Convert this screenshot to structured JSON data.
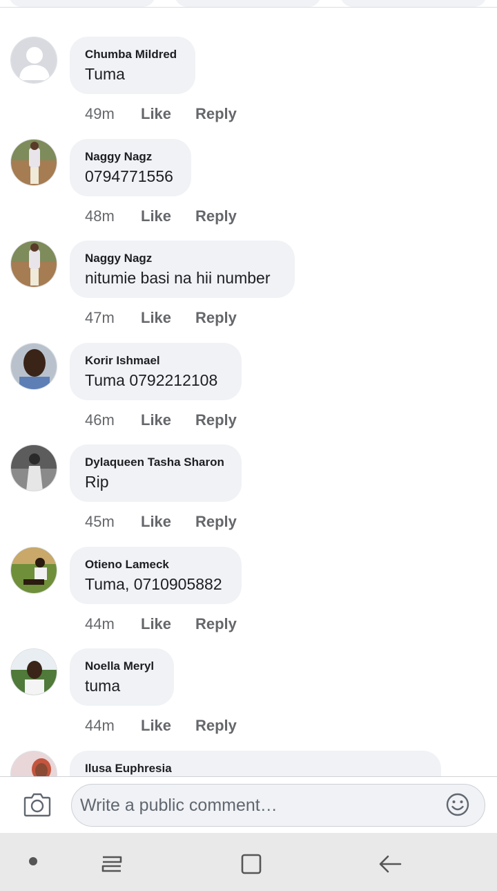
{
  "comments": [
    {
      "author": "Chumba Mildred",
      "text": "Tuma",
      "time": "49m",
      "like": "Like",
      "reply": "Reply",
      "avatar": "default"
    },
    {
      "author": "Naggy Nagz",
      "text": "0794771556",
      "time": "48m",
      "like": "Like",
      "reply": "Reply",
      "avatar": "photo"
    },
    {
      "author": "Naggy Nagz",
      "text": "nitumie basi na hii number",
      "time": "47m",
      "like": "Like",
      "reply": "Reply",
      "avatar": "photo"
    },
    {
      "author": "Korir Ishmael",
      "text": "Tuma 0792212108",
      "time": "46m",
      "like": "Like",
      "reply": "Reply",
      "avatar": "photo"
    },
    {
      "author": "Dylaqueen Tasha Sharon",
      "text": "Rip",
      "time": "45m",
      "like": "Like",
      "reply": "Reply",
      "avatar": "photo"
    },
    {
      "author": "Otieno Lameck",
      "text": "Tuma, 0710905882",
      "time": "44m",
      "like": "Like",
      "reply": "Reply",
      "avatar": "photo"
    },
    {
      "author": "Noella Meryl",
      "text": "tuma",
      "time": "44m",
      "like": "Like",
      "reply": "Reply",
      "avatar": "photo"
    },
    {
      "author": "Ilusa Euphresia",
      "text": "",
      "time": "",
      "like": "",
      "reply": "",
      "avatar": "photo"
    }
  ],
  "composer": {
    "placeholder": "Write a public comment…",
    "camera_icon": "camera-icon",
    "emoji_icon": "smiley-icon"
  },
  "navbar": {
    "icons": [
      "dot-icon",
      "recent-apps-icon",
      "home-icon",
      "back-icon"
    ]
  }
}
